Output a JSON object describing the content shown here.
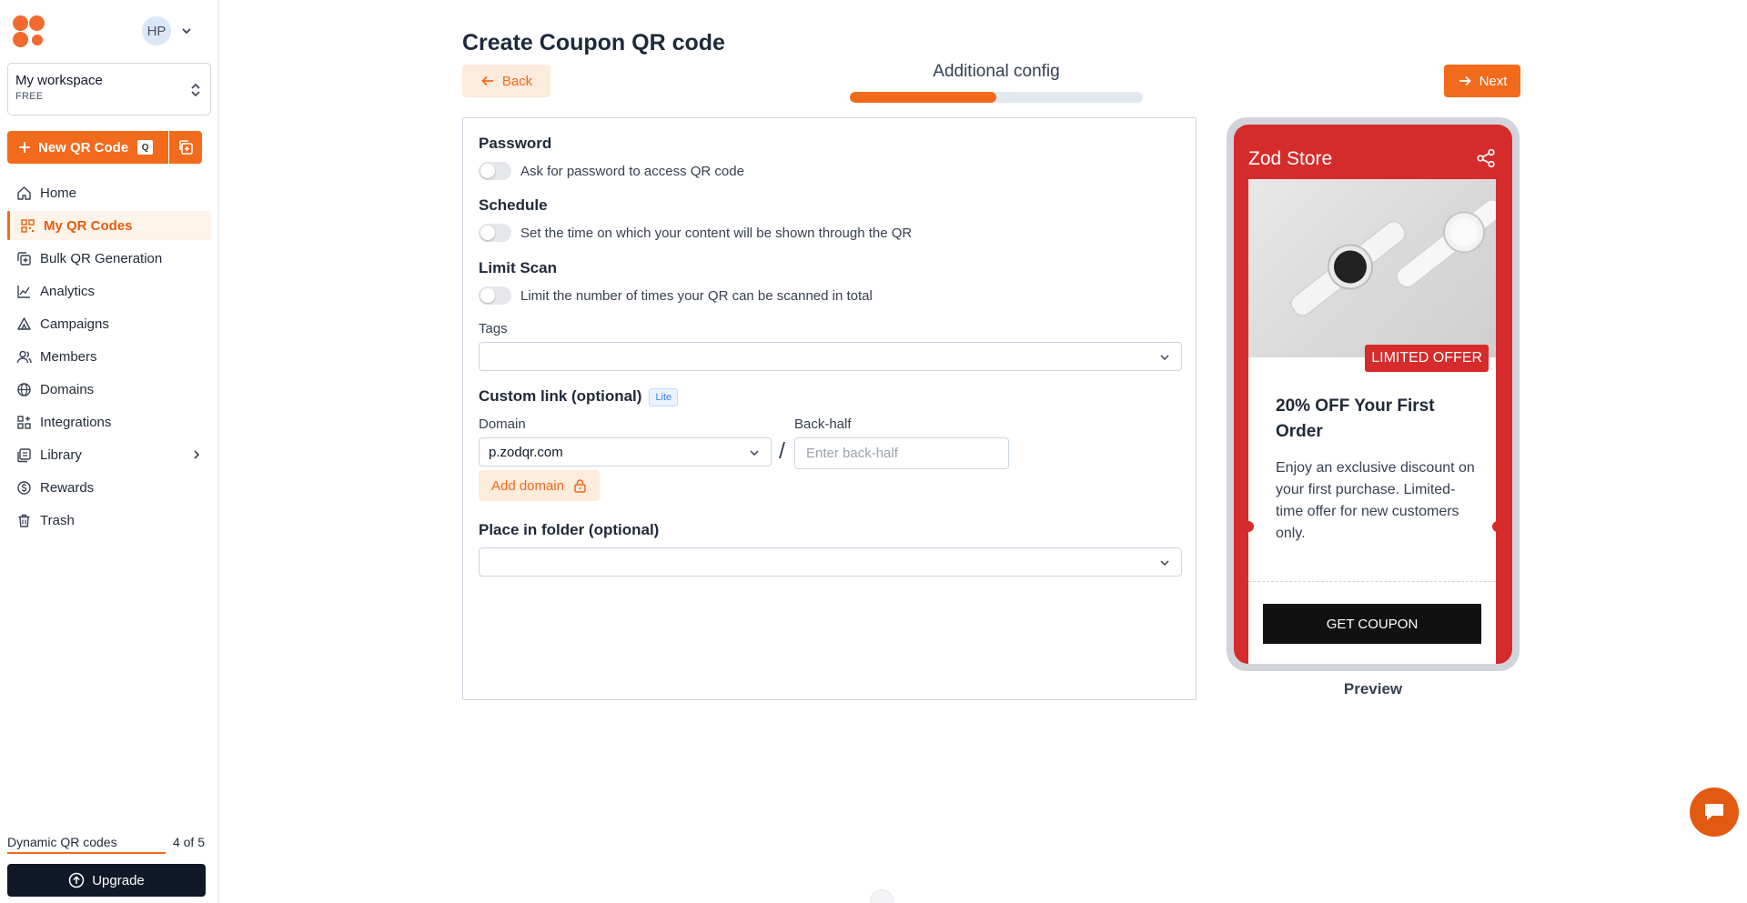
{
  "sidebar": {
    "avatar_initials": "HP",
    "workspace": {
      "name": "My workspace",
      "plan": "FREE"
    },
    "new_qr": {
      "label": "New QR Code",
      "shortcut": "Q"
    },
    "items": [
      {
        "label": "Home",
        "icon": "home-icon"
      },
      {
        "label": "My QR Codes",
        "icon": "qr-grid-icon",
        "active": true
      },
      {
        "label": "Bulk QR Generation",
        "icon": "bulk-copy-icon"
      },
      {
        "label": "Analytics",
        "icon": "chart-icon"
      },
      {
        "label": "Campaigns",
        "icon": "campaign-icon"
      },
      {
        "label": "Members",
        "icon": "members-icon"
      },
      {
        "label": "Domains",
        "icon": "globe-icon"
      },
      {
        "label": "Integrations",
        "icon": "integrations-icon"
      },
      {
        "label": "Library",
        "icon": "library-icon"
      },
      {
        "label": "Rewards",
        "icon": "coin-icon"
      },
      {
        "label": "Trash",
        "icon": "trash-icon"
      }
    ],
    "usage": {
      "label": "Dynamic QR codes",
      "count": "4 of 5",
      "fraction": 0.8
    },
    "upgrade_label": "Upgrade"
  },
  "header": {
    "title": "Create Coupon QR code",
    "back_label": "Back",
    "next_label": "Next",
    "step_label": "Additional config",
    "progress": 0.5
  },
  "form": {
    "password": {
      "title": "Password",
      "description": "Ask for password to access QR code",
      "enabled": false
    },
    "schedule": {
      "title": "Schedule",
      "description": "Set the time on which your content will be shown through the QR",
      "enabled": false
    },
    "limit_scan": {
      "title": "Limit Scan",
      "description": "Limit the number of times your QR can be scanned in total",
      "enabled": false
    },
    "tags": {
      "label": "Tags",
      "value": ""
    },
    "custom_link": {
      "title": "Custom link (optional)",
      "badge": "Lite",
      "domain_label": "Domain",
      "domain_value": "p.zodqr.com",
      "separator": "/",
      "backhalf_label": "Back-half",
      "backhalf_placeholder": "Enter back-half",
      "add_domain_label": "Add domain"
    },
    "folder": {
      "title": "Place in folder (optional)",
      "value": ""
    }
  },
  "preview": {
    "store_name": "Zod Store",
    "badge": "LIMITED OFFER",
    "title": "20% OFF Your First Order",
    "description": "Enjoy an exclusive discount on your first purchase. Limited-time offer for new customers only.",
    "cta": "GET COUPON",
    "label": "Preview",
    "colors": {
      "primary": "#d62b2b",
      "cta": "#111111"
    }
  },
  "colors": {
    "accent": "#f26a1b"
  }
}
